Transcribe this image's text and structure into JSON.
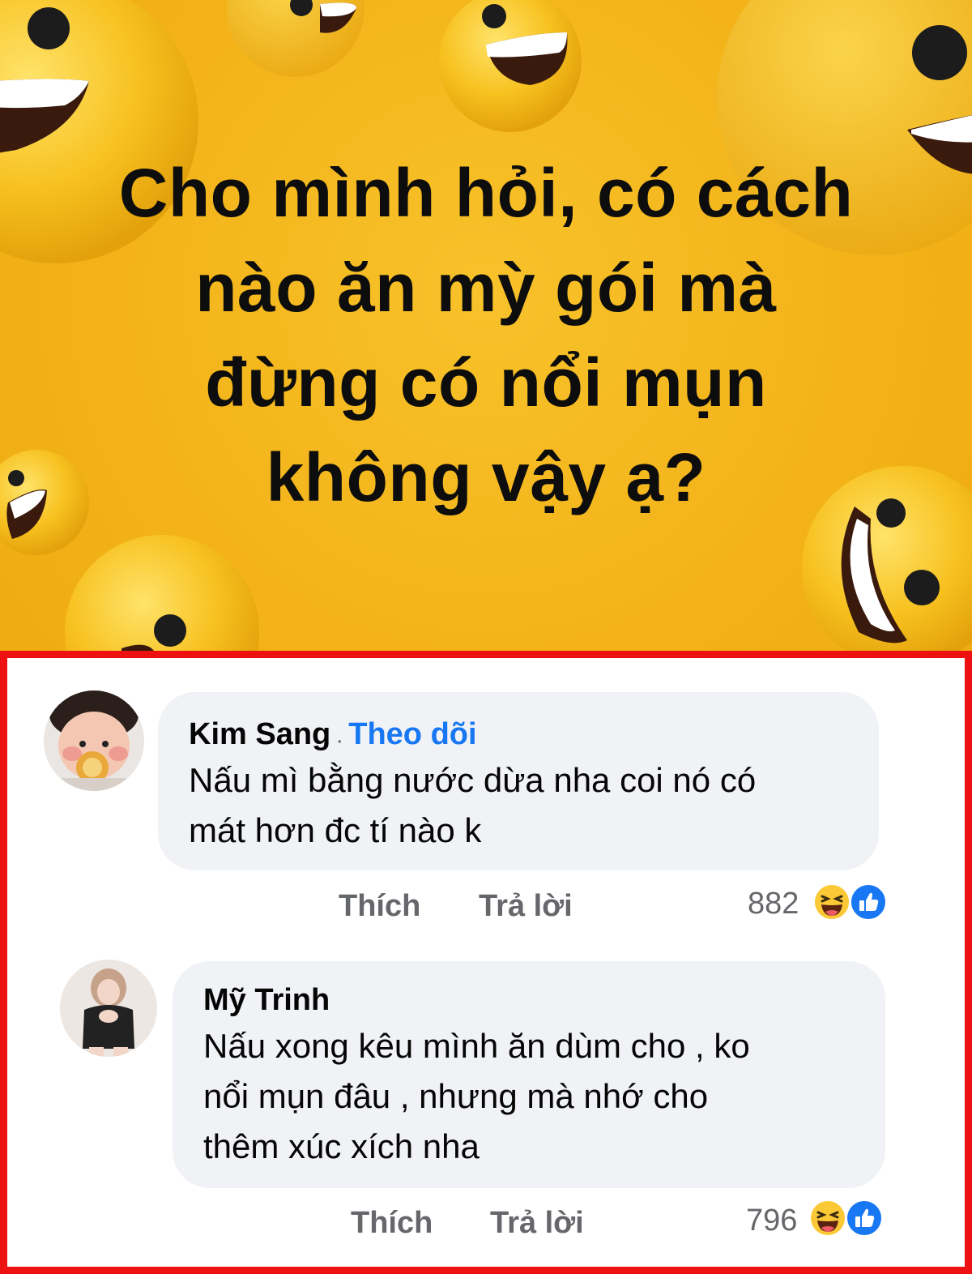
{
  "post": {
    "question_lines": [
      "Cho mình hỏi, có cách",
      "nào ăn mỳ gói mà",
      "đừng có nổi mụn",
      "không vậy ạ?"
    ],
    "background_color": "#f3b319"
  },
  "comments": [
    {
      "author": "Kim Sang",
      "separator": "·",
      "follow_label": "Theo dõi",
      "text_lines": [
        "Nấu mì bằng nước dừa nha coi nó có",
        "mát hơn đc tí nào k"
      ],
      "like_label": "Thích",
      "reply_label": "Trả lời",
      "reaction_count": "882",
      "reaction_icons": [
        "haha-icon",
        "like-icon"
      ]
    },
    {
      "author": "Mỹ Trinh",
      "text_lines": [
        "Nấu xong kêu mình ăn dùm cho , ko",
        "nổi mụn đâu , nhưng mà nhớ cho",
        "thêm xúc xích nha"
      ],
      "like_label": "Thích",
      "reply_label": "Trả lời",
      "reaction_count": "796",
      "reaction_icons": [
        "haha-icon",
        "like-icon"
      ]
    }
  ],
  "colors": {
    "highlight_border": "#ee1111",
    "bubble": "#f0f2f5",
    "link_blue": "#1877f2",
    "muted_text": "#65676b"
  }
}
